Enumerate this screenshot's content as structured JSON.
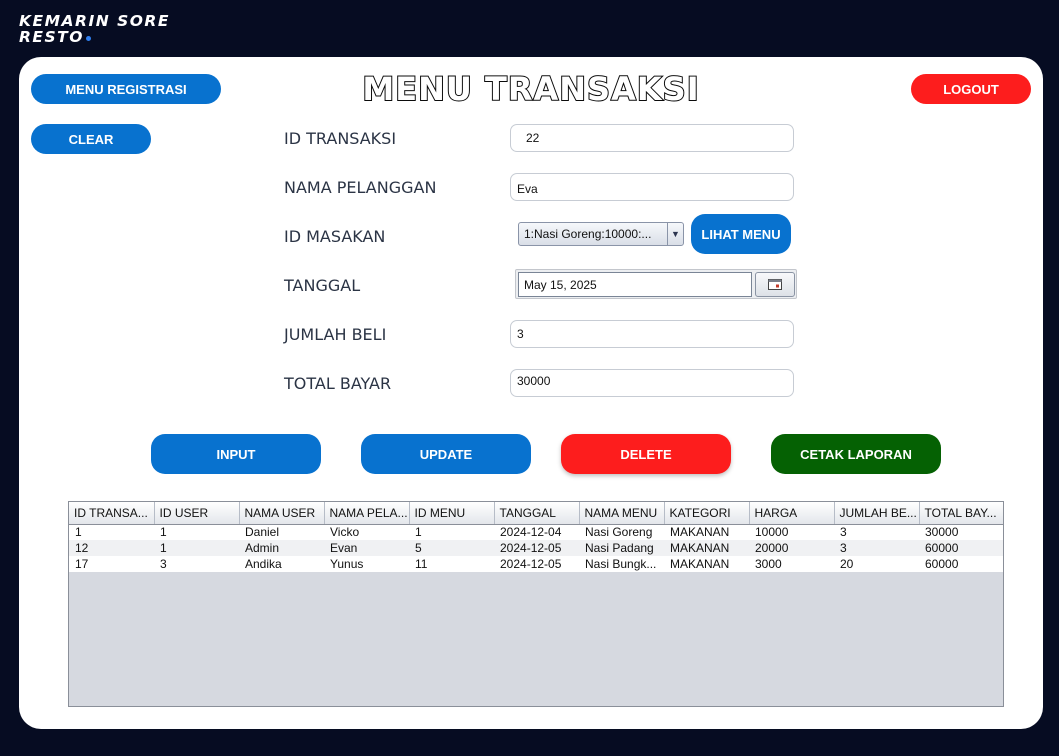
{
  "brand": {
    "line1": "KEMARIN SORE",
    "line2": "RESTO"
  },
  "header": {
    "title": "MENU TRANSAKSI",
    "registration_button": "MENU REGISTRASI",
    "logout_button": "LOGOUT",
    "clear_button": "CLEAR"
  },
  "form": {
    "id_transaksi": {
      "label": "ID TRANSAKSI",
      "value": "22"
    },
    "nama_pelanggan": {
      "label": "NAMA PELANGGAN",
      "value": "Eva"
    },
    "id_masakan": {
      "label": "ID MASAKAN",
      "selected": "1:Nasi Goreng:10000:...",
      "lihat_menu_button": "LIHAT MENU"
    },
    "tanggal": {
      "label": "TANGGAL",
      "value": "May 15, 2025"
    },
    "jumlah_beli": {
      "label": "JUMLAH BELI",
      "value": "3"
    },
    "total_bayar": {
      "label": "TOTAL BAYAR",
      "value": "30000"
    }
  },
  "actions": {
    "input": "INPUT",
    "update": "UPDATE",
    "delete": "DELETE",
    "cetak": "CETAK LAPORAN"
  },
  "table": {
    "columns": [
      "ID TRANSA...",
      "ID USER",
      "NAMA USER",
      "NAMA PELA...",
      "ID MENU",
      "TANGGAL",
      "NAMA MENU",
      "KATEGORI",
      "HARGA",
      "JUMLAH BE...",
      "TOTAL BAY..."
    ],
    "rows": [
      [
        "1",
        "1",
        "Daniel",
        "Vicko",
        "1",
        "2024-12-04",
        "Nasi Goreng",
        "MAKANAN",
        "10000",
        "3",
        "30000"
      ],
      [
        "12",
        "1",
        "Admin",
        "Evan",
        "5",
        "2024-12-05",
        "Nasi Padang",
        "MAKANAN",
        "20000",
        "3",
        "60000"
      ],
      [
        "17",
        "3",
        "Andika",
        "Yunus",
        "11",
        "2024-12-05",
        "Nasi Bungk...",
        "MAKANAN",
        "3000",
        "20",
        "60000"
      ]
    ]
  },
  "colors": {
    "background": "#060c22",
    "primary_blue": "#0872cf",
    "danger_red": "#fd1d1d",
    "success_green": "#056103"
  }
}
